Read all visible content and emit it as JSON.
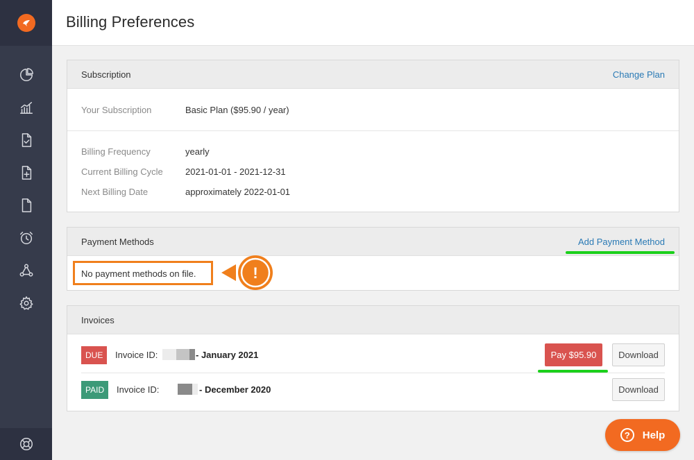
{
  "page": {
    "title": "Billing Preferences"
  },
  "colors": {
    "brand": "#f26a21",
    "link": "#2a7ab5",
    "due": "#d9534f",
    "paid": "#3c9a78",
    "highlight": "#1bd01b",
    "callout": "#f07f1c"
  },
  "sidebar": {
    "logo_icon": "bird-logo-icon",
    "items": [
      {
        "icon": "pie-chart-icon"
      },
      {
        "icon": "bar-chart-icon"
      },
      {
        "icon": "document-check-icon"
      },
      {
        "icon": "document-add-icon"
      },
      {
        "icon": "document-icon"
      },
      {
        "icon": "alarm-clock-icon"
      },
      {
        "icon": "network-icon"
      },
      {
        "icon": "gear-icon"
      }
    ],
    "bottom_icon": "lifebuoy-icon"
  },
  "subscription": {
    "title": "Subscription",
    "action": "Change Plan",
    "your_subscription_label": "Your Subscription",
    "your_subscription_value": "Basic Plan ($95.90 / year)",
    "billing_frequency_label": "Billing Frequency",
    "billing_frequency_value": "yearly",
    "current_cycle_label": "Current Billing Cycle",
    "current_cycle_value": "2021-01-01 - 2021-12-31",
    "next_date_label": "Next Billing Date",
    "next_date_value": "approximately 2022-01-01"
  },
  "payment_methods": {
    "title": "Payment Methods",
    "action": "Add Payment Method",
    "empty_text": "No payment methods on file.",
    "callout_symbol": "!"
  },
  "invoices": {
    "title": "Invoices",
    "items": [
      {
        "status": "DUE",
        "id_label": "Invoice ID:",
        "period": "- January 2021",
        "pay_label": "Pay $95.90",
        "download_label": "Download"
      },
      {
        "status": "PAID",
        "id_label": "Invoice ID:",
        "period": "- December 2020",
        "download_label": "Download"
      }
    ]
  },
  "help": {
    "label": "Help",
    "icon": "?"
  }
}
